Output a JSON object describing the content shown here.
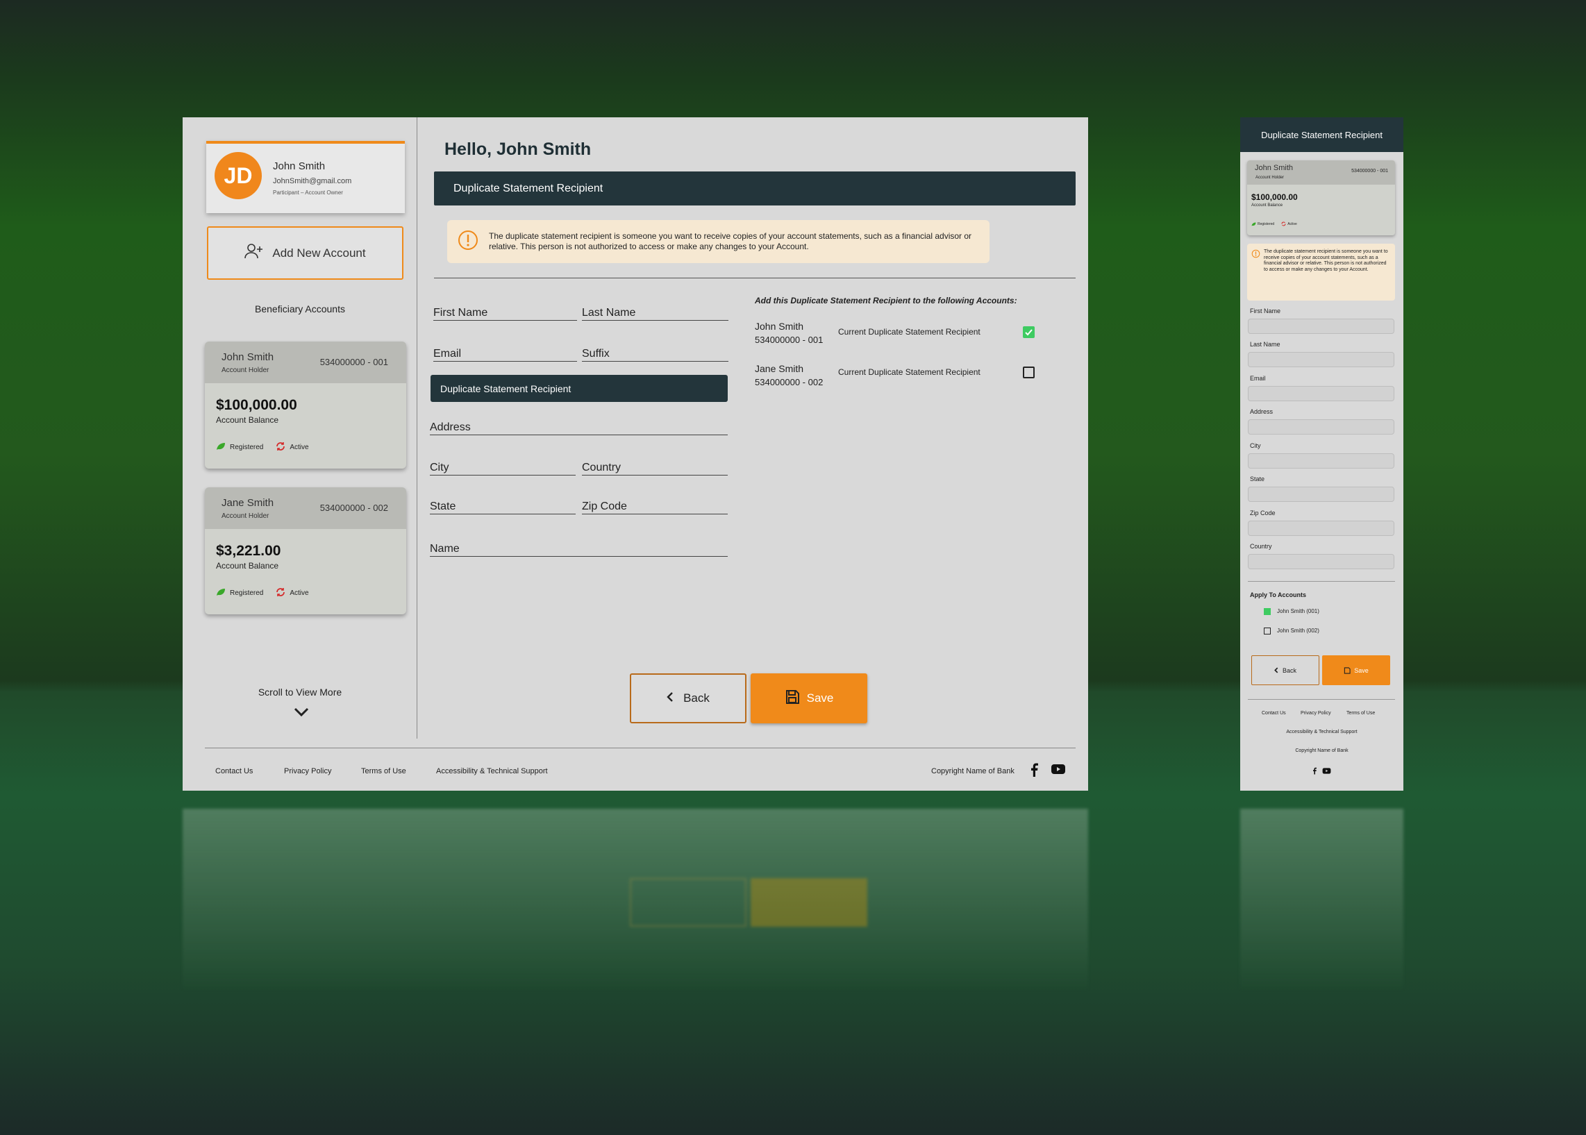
{
  "profile": {
    "initials": "JD",
    "name": "John Smith",
    "email": "JohnSmith@gmail.com",
    "role": "Participant – Account Owner"
  },
  "sidebar": {
    "add_account_label": "Add New Account",
    "beneficiary_title": "Beneficiary Accounts",
    "scroll_label": "Scroll to View More",
    "accounts": [
      {
        "name": "John Smith",
        "role": "Account Holder",
        "number": "534000000 - 001",
        "balance": "$100,000.00",
        "balance_label": "Account Balance",
        "status1": "Registered",
        "status2": "Active"
      },
      {
        "name": "Jane Smith",
        "role": "Account Holder",
        "number": "534000000 - 002",
        "balance": "$3,221.00",
        "balance_label": "Account Balance",
        "status1": "Registered",
        "status2": "Active"
      }
    ]
  },
  "main": {
    "greeting": "Hello, John Smith",
    "section_title": "Duplicate Statement Recipient",
    "notice": "The duplicate statement recipient is someone you want to receive copies of your account statements, such as a financial advisor or relative. This person is not authorized to access or make any changes to your Account.",
    "fields": {
      "first_name": "First Name",
      "last_name": "Last Name",
      "email": "Email",
      "suffix": "Suffix",
      "address": "Address",
      "city": "City",
      "country": "Country",
      "state": "State",
      "zip": "Zip Code",
      "name": "Name"
    },
    "dsr_bar": "Duplicate Statement Recipient",
    "apply_title": "Add this Duplicate Statement Recipient to the following Accounts:",
    "apply_accounts": [
      {
        "name": "John Smith",
        "number": "534000000 - 001",
        "label": "Current Duplicate Statement Recipient",
        "checked": true
      },
      {
        "name": "Jane Smith",
        "number": "534000000 - 002",
        "label": "Current Duplicate Statement Recipient",
        "checked": false
      }
    ],
    "back_label": "Back",
    "save_label": "Save"
  },
  "footer": {
    "contact": "Contact Us",
    "privacy": "Privacy Policy",
    "terms": "Terms of Use",
    "accessibility": "Accessibility & Technical Support",
    "copyright": "Copyright Name of Bank"
  },
  "mobile": {
    "header": "Duplicate Statement Recipient",
    "card": {
      "name": "John Smith",
      "number": "534000000 - 001",
      "role": "Account Holder",
      "balance": "$100,000.00",
      "balance_label": "Account Balance",
      "status1": "Registered",
      "status2": "Active"
    },
    "notice": "The duplicate statement recipient is someone you want to receive copies of your account statements, such as a financial advisor or relative. This person is not authorized to access or make any changes to your Account.",
    "labels": [
      "First Name",
      "Last Name",
      "Email",
      "Address",
      "City",
      "State",
      "Zip Code",
      "Country"
    ],
    "apply_title": "Apply To Accounts",
    "apply": [
      {
        "label": "John Smith (001)",
        "checked": true
      },
      {
        "label": "John Smith (002)",
        "checked": false
      }
    ],
    "back_label": "Back",
    "save_label": "Save",
    "footer_contact": "Contact Us",
    "footer_privacy": "Privacy Policy",
    "footer_terms": "Terms of Use",
    "footer_accessibility": "Accessibility & Technical Support",
    "footer_copyright": "Copyright Name of Bank"
  },
  "colors": {
    "accent": "#f08a1a",
    "dark_bar": "#23353b",
    "check_green": "#3ecb61",
    "background": "#1f5c1a"
  }
}
